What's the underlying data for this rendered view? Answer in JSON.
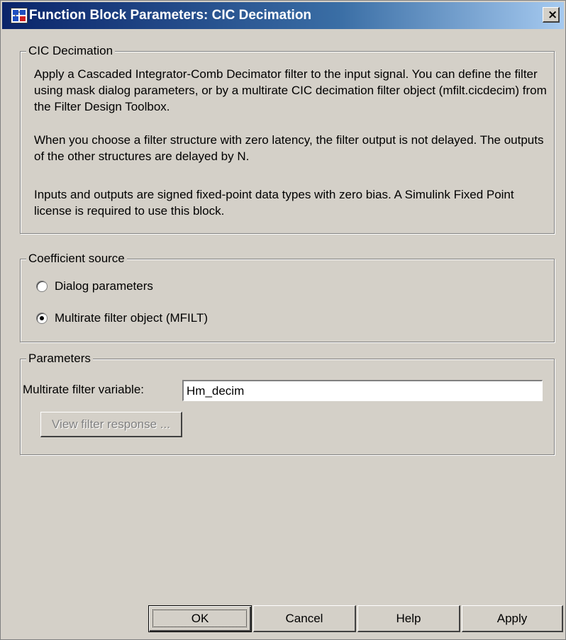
{
  "window": {
    "title": "Function Block Parameters: CIC Decimation",
    "close_label": "×"
  },
  "description": {
    "group_title": "CIC Decimation",
    "paragraph1": "Apply a Cascaded Integrator-Comb Decimator filter to the input signal. You can define the filter using mask dialog parameters, or by a multirate CIC decimation filter object (mfilt.cicdecim) from the Filter Design Toolbox.",
    "paragraph2": "When you choose a filter structure with zero latency, the filter output is not delayed. The outputs of the other structures are delayed by N.",
    "paragraph3": "Inputs and outputs are signed fixed-point data types with zero bias.  A Simulink Fixed Point license is required to use this block."
  },
  "coefficient_source": {
    "group_title": "Coefficient source",
    "options": [
      {
        "label": "Dialog parameters",
        "selected": false
      },
      {
        "label": "Multirate filter object (MFILT)",
        "selected": true
      }
    ]
  },
  "parameters": {
    "group_title": "Parameters",
    "filter_variable_label": "Multirate filter variable:",
    "filter_variable_value": "Hm_decim",
    "view_response_label": "View filter response ..."
  },
  "buttons": {
    "ok": "OK",
    "cancel": "Cancel",
    "help": "Help",
    "apply": "Apply"
  },
  "icons": {
    "app": "simulink-block-icon",
    "close": "close-icon"
  }
}
